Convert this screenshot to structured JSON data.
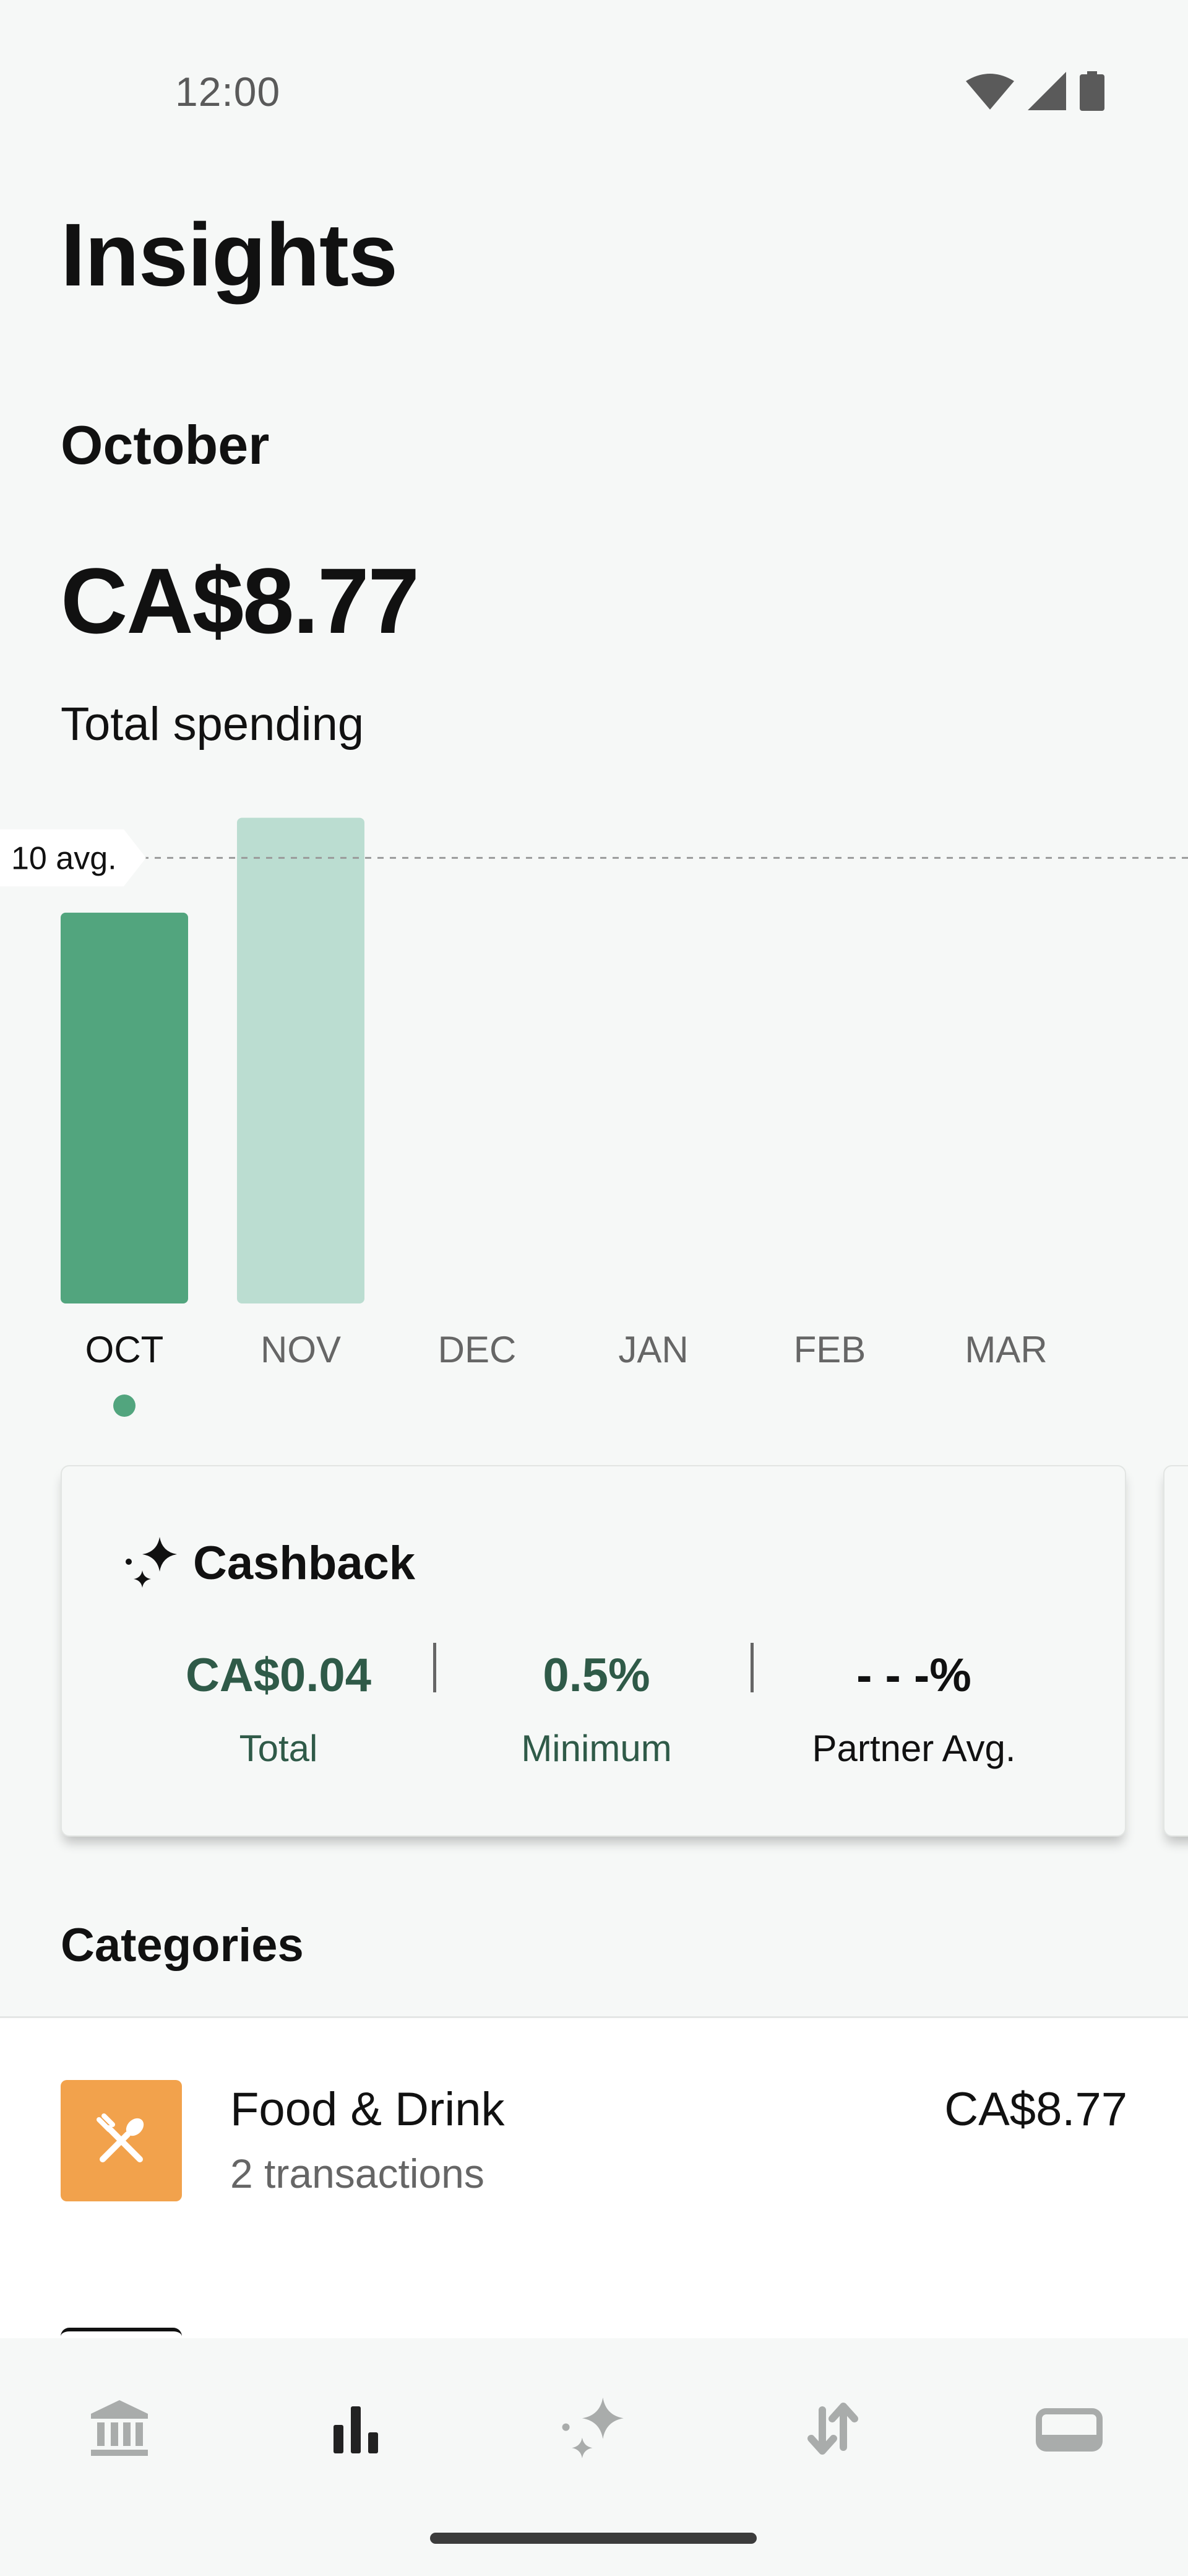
{
  "status_bar": {
    "time": "12:00"
  },
  "header": {
    "title": "Insights"
  },
  "summary": {
    "month": "October",
    "amount": "CA$8.77",
    "caption": "Total spending"
  },
  "chart_data": {
    "type": "bar",
    "categories": [
      "OCT",
      "NOV",
      "DEC",
      "JAN",
      "FEB",
      "MAR"
    ],
    "values": [
      8.77,
      10.9,
      null,
      null,
      null,
      null
    ],
    "selected": "OCT",
    "average": 10,
    "average_label": "10 avg.",
    "ylim": [
      0,
      11.2
    ],
    "colors": {
      "selected": "#52a57e",
      "other": "#bbddd1"
    }
  },
  "cashback": {
    "title": "Cashback",
    "stats": [
      {
        "value": "CA$0.04",
        "label": "Total"
      },
      {
        "value": "0.5%",
        "label": "Minimum"
      },
      {
        "value": "- - -%",
        "label": "Partner Avg."
      }
    ]
  },
  "categories": {
    "title": "Categories",
    "items": [
      {
        "name": "Food & Drink",
        "sub": "2 transactions",
        "amount": "CA$8.77",
        "icon": "utensils-icon",
        "color": "#f2a24c"
      }
    ]
  },
  "nav": {
    "items": [
      {
        "icon": "bank-icon",
        "active": false
      },
      {
        "icon": "insights-icon",
        "active": true
      },
      {
        "icon": "sparkle-icon",
        "active": false
      },
      {
        "icon": "transfer-icon",
        "active": false
      },
      {
        "icon": "card-icon",
        "active": false
      }
    ]
  }
}
